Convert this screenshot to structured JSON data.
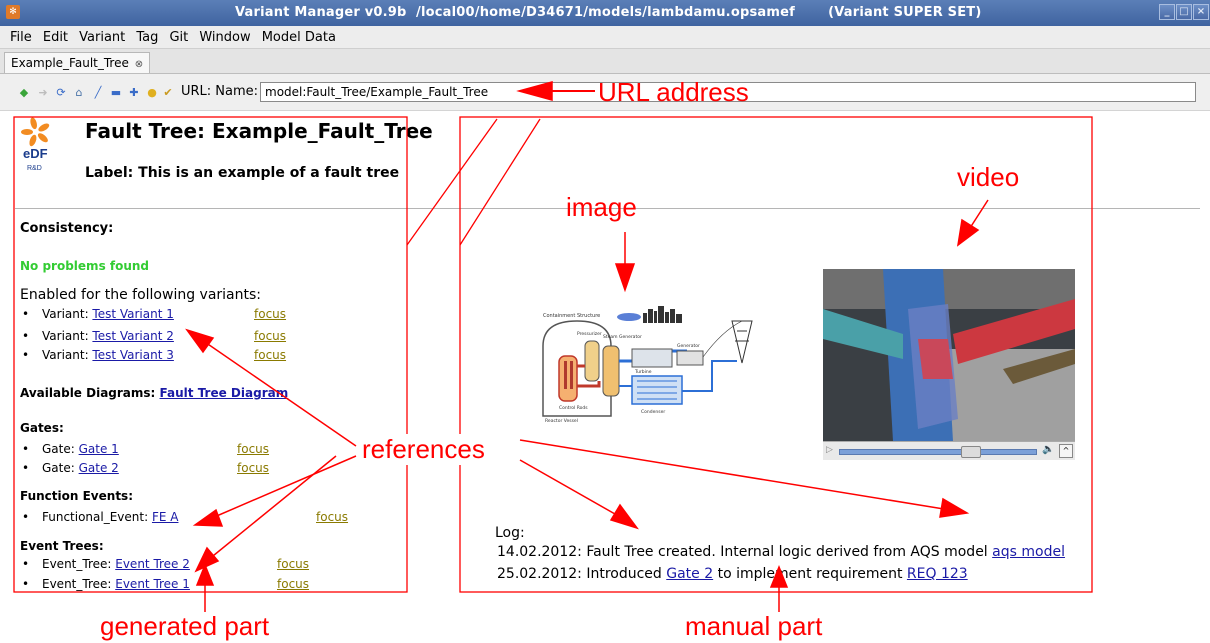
{
  "window": {
    "title": "Variant Manager v0.9b  /local00/home/D34671/models/lambdamu.opsamef       (Variant SUPER SET)"
  },
  "menu": [
    "File",
    "Edit",
    "Variant",
    "Tag",
    "Git",
    "Window",
    "Model Data"
  ],
  "tab": {
    "label": "Example_Fault_Tree",
    "close_glyph": "⊗"
  },
  "toolbar": {
    "icons": [
      "back-icon",
      "forward-icon",
      "refresh-icon",
      "home-icon",
      "edit-icon",
      "view-icon",
      "add-icon",
      "bulb-icon",
      "check-icon"
    ],
    "url_label": "URL:  Name:",
    "url_value": "model:Fault_Tree/Example_Fault_Tree"
  },
  "page": {
    "title": "Fault Tree: Example_Fault_Tree",
    "label": "Label: This is an example of a fault tree",
    "logo_text": "eDF",
    "logo_sub": "R&D",
    "consistency_heading": "Consistency:",
    "consistency_status": "No problems found",
    "enabled_heading": "Enabled for the following variants:",
    "variants": [
      {
        "prefix": "Variant: ",
        "link": "Test Variant 1",
        "focus": "focus"
      },
      {
        "prefix": "Variant: ",
        "link": "Test Variant 2",
        "focus": "focus"
      },
      {
        "prefix": "Variant: ",
        "link": "Test Variant 3",
        "focus": "focus"
      }
    ],
    "diagrams_label": "Available Diagrams: ",
    "diagrams_link": "Fault Tree Diagram",
    "gates_heading": "Gates:",
    "gates": [
      {
        "prefix": "Gate: ",
        "link": "Gate 1",
        "focus": "focus"
      },
      {
        "prefix": "Gate: ",
        "link": "Gate 2",
        "focus": "focus"
      }
    ],
    "function_events_heading": "Function Events:",
    "function_events": [
      {
        "prefix": "Functional_Event: ",
        "link": "FE A",
        "focus": "focus"
      }
    ],
    "event_trees_heading": "Event Trees:",
    "event_trees": [
      {
        "prefix": "Event_Tree: ",
        "link": "Event Tree 2",
        "focus": "focus"
      },
      {
        "prefix": "Event_Tree: ",
        "link": "Event Tree 1",
        "focus": "focus"
      }
    ],
    "log_heading": "Log:",
    "log": [
      {
        "date": "14.02.2012: ",
        "text": "Fault Tree created. Internal logic derived from AQS model ",
        "link": "aqs model",
        "tail": ""
      },
      {
        "date": "25.02.2012: ",
        "text": "Introduced ",
        "link": "Gate 2",
        "tail": " to implement requirement ",
        "link2": "REQ 123"
      }
    ],
    "diagram_labels": {
      "containment": "Containment Structure",
      "pressurizer": "Pressurizer",
      "steam_gen": "Steam Generator",
      "generator": "Generator",
      "turbine": "Turbine",
      "control_rods": "Control Rods",
      "reactor_vessel": "Reactor Vessel",
      "condenser": "Condenser"
    }
  },
  "annotations": {
    "url_address": "URL address",
    "image": "image",
    "video": "video",
    "references": "references",
    "generated_part": "generated part",
    "manual_part": "manual part",
    "color": "#ff0000"
  }
}
